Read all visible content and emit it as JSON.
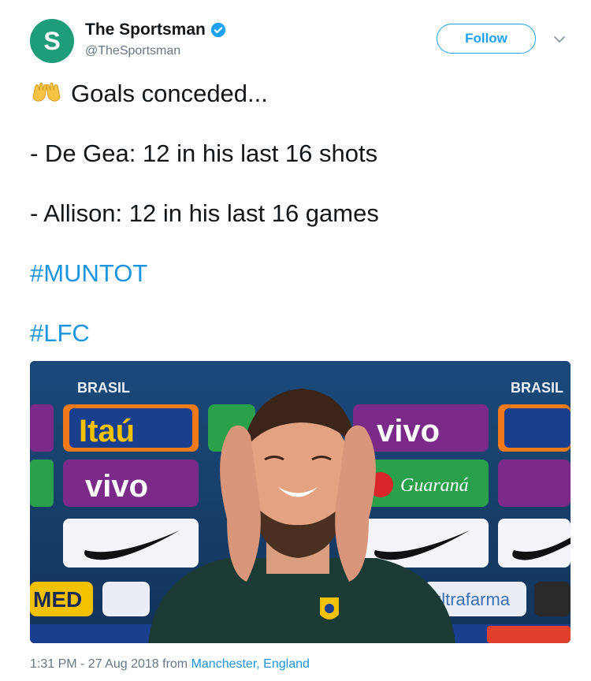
{
  "user": {
    "avatar_letter": "S",
    "display_name": "The Sportsman",
    "handle": "@TheSportsman",
    "verified": true
  },
  "actions": {
    "follow_label": "Follow"
  },
  "tweet": {
    "emoji": "raising-hands-icon",
    "intro": "Goals conceded...",
    "line1": "- De Gea: 12 in his last 16 shots",
    "line2": "- Allison: 12 in his last 16 games",
    "hashtag1": "#MUNTOT",
    "hashtag2": "#LFC"
  },
  "media": {
    "sponsor_board_texts": [
      "BRASIL",
      "BRASIL",
      "Itaú",
      "vivo",
      "vivo",
      "Guaraná",
      "MED",
      "ultrafarma"
    ]
  },
  "footer": {
    "timestamp": "1:31 PM - 27 Aug 2018 from ",
    "location": "Manchester, England"
  },
  "colors": {
    "accent": "#1da1f2",
    "link": "#1b95e0",
    "avatar_bg": "#1f9c7a",
    "muted_text": "#657786"
  }
}
